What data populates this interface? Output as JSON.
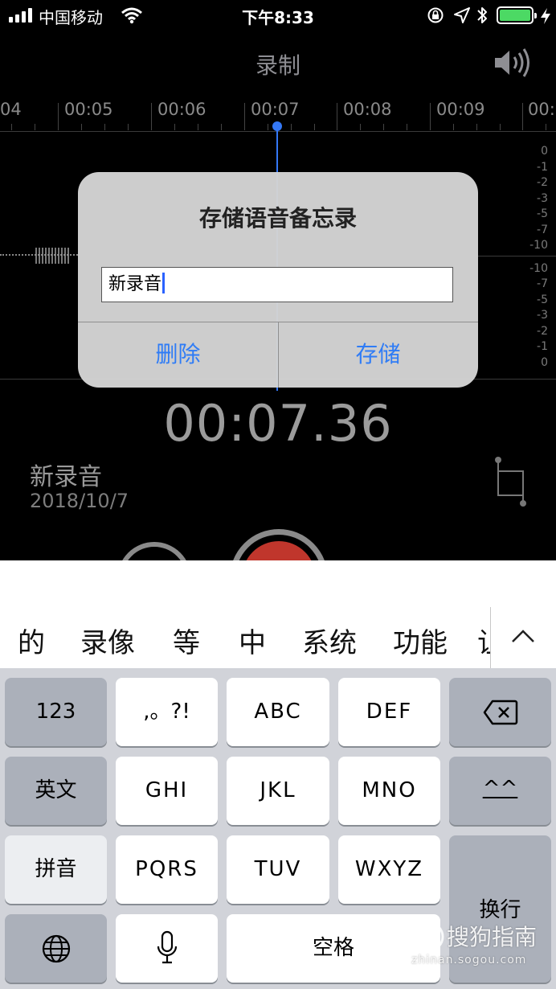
{
  "status_bar": {
    "carrier": "中国移动",
    "time": "下午8:33"
  },
  "header": {
    "title": "录制",
    "speaker_icon": "speaker-icon"
  },
  "timeline": {
    "tick_labels": [
      "04",
      "00:05",
      "00:06",
      "00:07",
      "00:08",
      "00:09",
      "00:"
    ],
    "db_top": [
      "0",
      "-1",
      "-2",
      "-3",
      "-5",
      "-7",
      "-10"
    ],
    "db_bottom": [
      "-10",
      "-7",
      "-5",
      "-3",
      "-2",
      "-1",
      "0"
    ],
    "playhead_color": "#3478f6"
  },
  "dialog": {
    "title": "存储语音备忘录",
    "field_value": "新录音",
    "delete_label": "删除",
    "save_label": "存储",
    "button_color": "#2f7cf6"
  },
  "recorder": {
    "elapsed": "00:07.36",
    "name": "新录音",
    "date": "2018/10/7",
    "record_color": "#c0362c"
  },
  "keyboard": {
    "candidates": [
      "的",
      "录像",
      "等",
      "中",
      "系统",
      "功能",
      "让"
    ],
    "collapse_icon": "chevron-up-icon",
    "keys": {
      "num": "123",
      "punct": ",。?!",
      "abc": "ABC",
      "def": "DEF",
      "delete_icon": "backspace-icon",
      "english": "英文",
      "ghi": "GHI",
      "jkl": "JKL",
      "mno": "MNO",
      "emoji": "^^",
      "pinyin": "拼音",
      "pqrs": "PQRS",
      "tuv": "TUV",
      "wxyz": "WXYZ",
      "return": "换行",
      "globe_icon": "globe-icon",
      "mic_icon": "microphone-icon",
      "space": "空格"
    }
  },
  "watermark": {
    "text": "搜狗指南",
    "url": "zhinan.sogou.com"
  }
}
